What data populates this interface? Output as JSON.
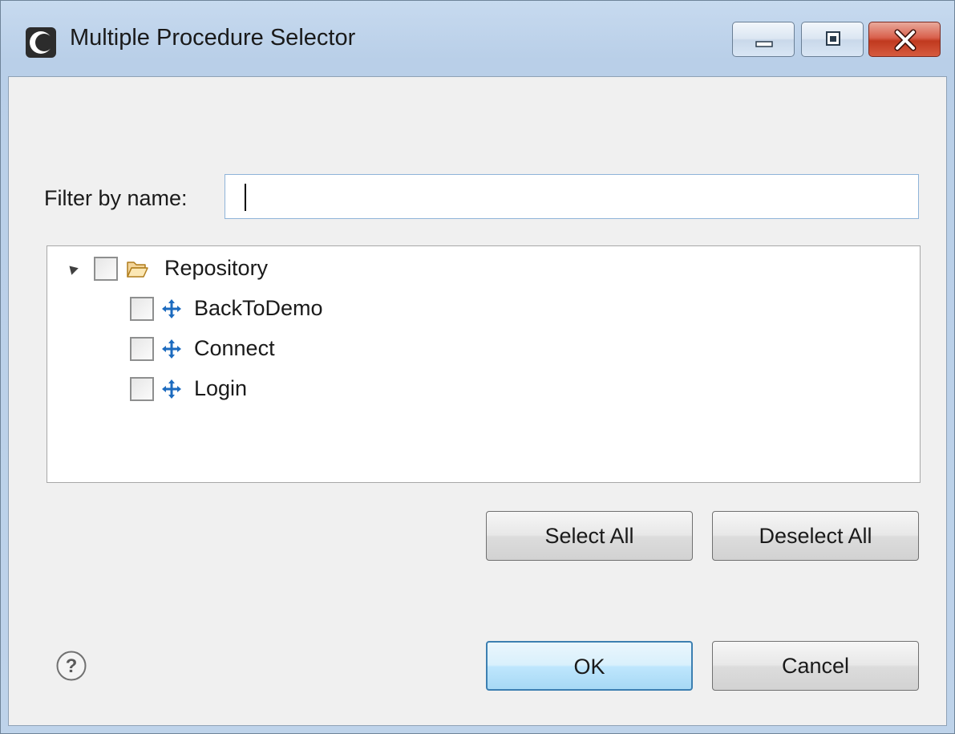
{
  "window": {
    "title": "Multiple Procedure Selector",
    "icons": {
      "app": "app-circle-icon",
      "minimize": "minimize-icon",
      "maximize": "maximize-icon",
      "close": "close-icon"
    }
  },
  "filter": {
    "label": "Filter by name:",
    "value": "",
    "placeholder": ""
  },
  "tree": {
    "root": {
      "label": "Repository",
      "icon": "folder-open-icon",
      "expanded": true,
      "checked": false
    },
    "items": [
      {
        "label": "BackToDemo",
        "icon": "procedure-icon",
        "checked": false
      },
      {
        "label": "Connect",
        "icon": "procedure-icon",
        "checked": false
      },
      {
        "label": "Login",
        "icon": "procedure-icon",
        "checked": false
      }
    ]
  },
  "buttons": {
    "select_all": "Select All",
    "deselect_all": "Deselect All",
    "ok": "OK",
    "cancel": "Cancel"
  },
  "help": {
    "icon": "help-icon"
  },
  "colors": {
    "frame": "#bed3ea",
    "client": "#f0f0f0",
    "close_button": "#c0391f",
    "focus_border": "#3c7fb1",
    "procedure_icon": "#1c6bbf",
    "folder_icon": "#e8b44a"
  }
}
